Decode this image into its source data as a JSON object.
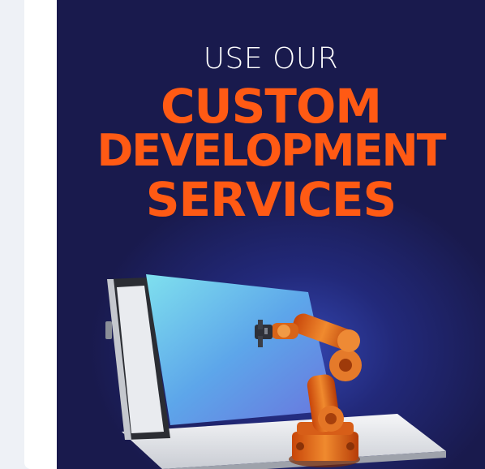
{
  "banner": {
    "line1": "USE OUR",
    "line2": "CUSTOM",
    "line3": "DEVELOPMENT",
    "line4": "SERVICES"
  },
  "colors": {
    "accent": "#ff5a14",
    "background": "#191a4d",
    "page": "#eef1f6"
  },
  "icons": {
    "illustration": "laptop-with-robot-arm-illustration"
  }
}
